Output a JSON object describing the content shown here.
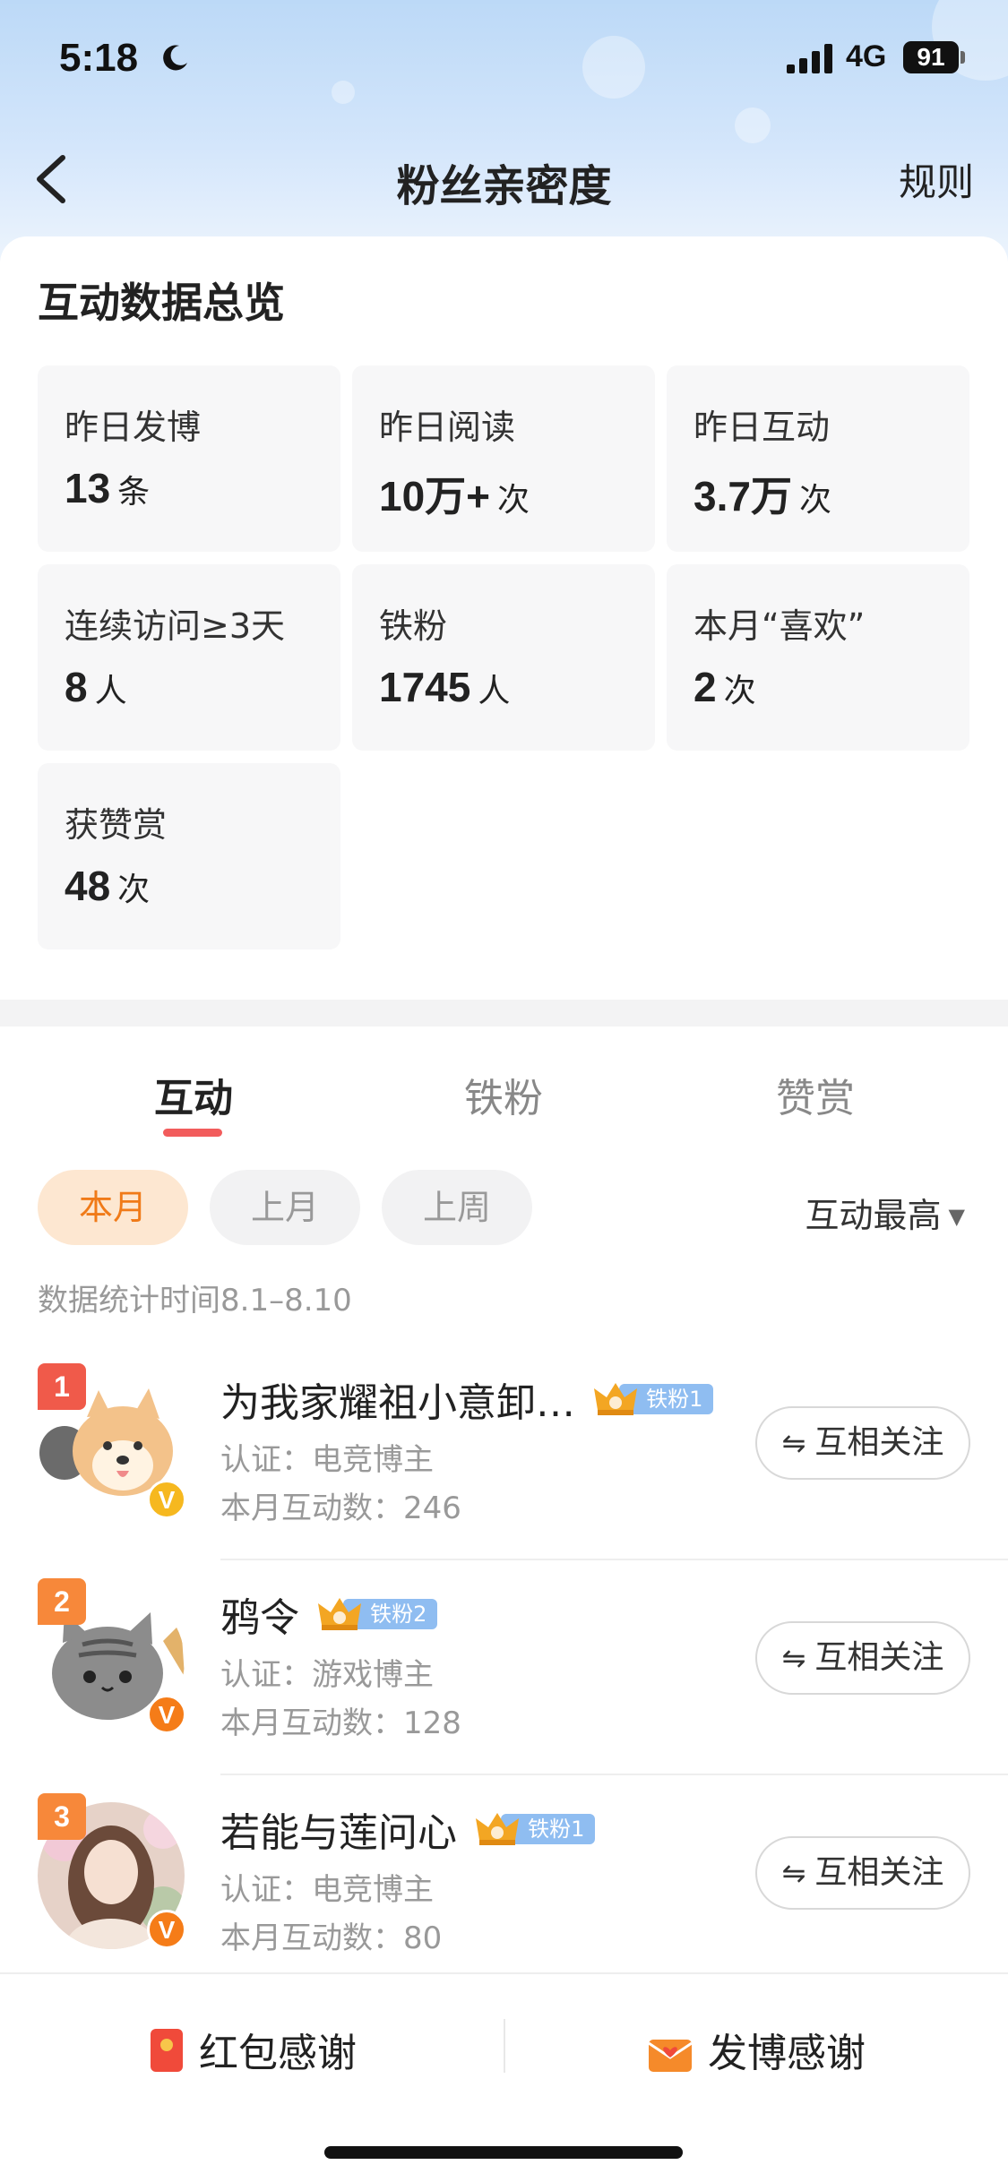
{
  "status_bar": {
    "time": "5:18",
    "network": "4G",
    "battery": "91"
  },
  "nav": {
    "title": "粉丝亲密度",
    "rules_label": "规则"
  },
  "overview": {
    "title": "互动数据总览",
    "stats": [
      {
        "label": "昨日发博",
        "value": "13",
        "unit": "条"
      },
      {
        "label": "昨日阅读",
        "value": "10万+",
        "unit": "次"
      },
      {
        "label": "昨日互动",
        "value": "3.7万",
        "unit": "次"
      },
      {
        "label": "连续访问≥3天",
        "value": "8",
        "unit": "人"
      },
      {
        "label": "铁粉",
        "value": "1745",
        "unit": "人"
      },
      {
        "label": "本月“喜欢”",
        "value": "2",
        "unit": "次"
      },
      {
        "label": "获赞赏",
        "value": "48",
        "unit": "次"
      }
    ]
  },
  "tabs": [
    {
      "label": "互动",
      "active": true
    },
    {
      "label": "铁粉",
      "active": false
    },
    {
      "label": "赞赏",
      "active": false
    }
  ],
  "filters": {
    "chips": [
      {
        "label": "本月",
        "active": true
      },
      {
        "label": "上月",
        "active": false
      },
      {
        "label": "上周",
        "active": false
      }
    ],
    "sort_label": "互动最高"
  },
  "period_text": "数据统计时间8.1–8.10",
  "fans": [
    {
      "rank": "1",
      "name": "为我家耀祖小意卸…",
      "badge": "铁粉1",
      "cert": "认证：电竞博主",
      "interactions": "本月互动数：246",
      "follow_label": "互相关注",
      "verified_color": "gold"
    },
    {
      "rank": "2",
      "name": "鸦令",
      "badge": "铁粉2",
      "cert": "认证：游戏博主",
      "interactions": "本月互动数：128",
      "follow_label": "互相关注",
      "verified_color": "orange"
    },
    {
      "rank": "3",
      "name": "若能与莲问心",
      "badge": "铁粉1",
      "cert": "认证：电竞博主",
      "interactions": "本月互动数：80",
      "follow_label": "互相关注",
      "verified_color": "orange"
    }
  ],
  "bottom_bar": {
    "red_packet_label": "红包感谢",
    "post_thanks_label": "发博感谢"
  },
  "colors": {
    "accent": "#f07a18",
    "tab_underline": "#f25c5c",
    "badge": "#8fbdf1"
  }
}
